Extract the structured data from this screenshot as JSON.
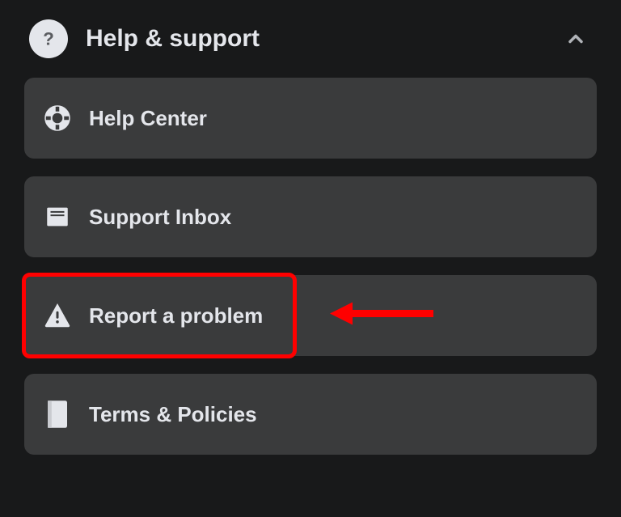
{
  "header": {
    "title": "Help & support"
  },
  "items": [
    {
      "label": "Help Center"
    },
    {
      "label": "Support Inbox"
    },
    {
      "label": "Report a problem"
    },
    {
      "label": "Terms & Policies"
    }
  ]
}
